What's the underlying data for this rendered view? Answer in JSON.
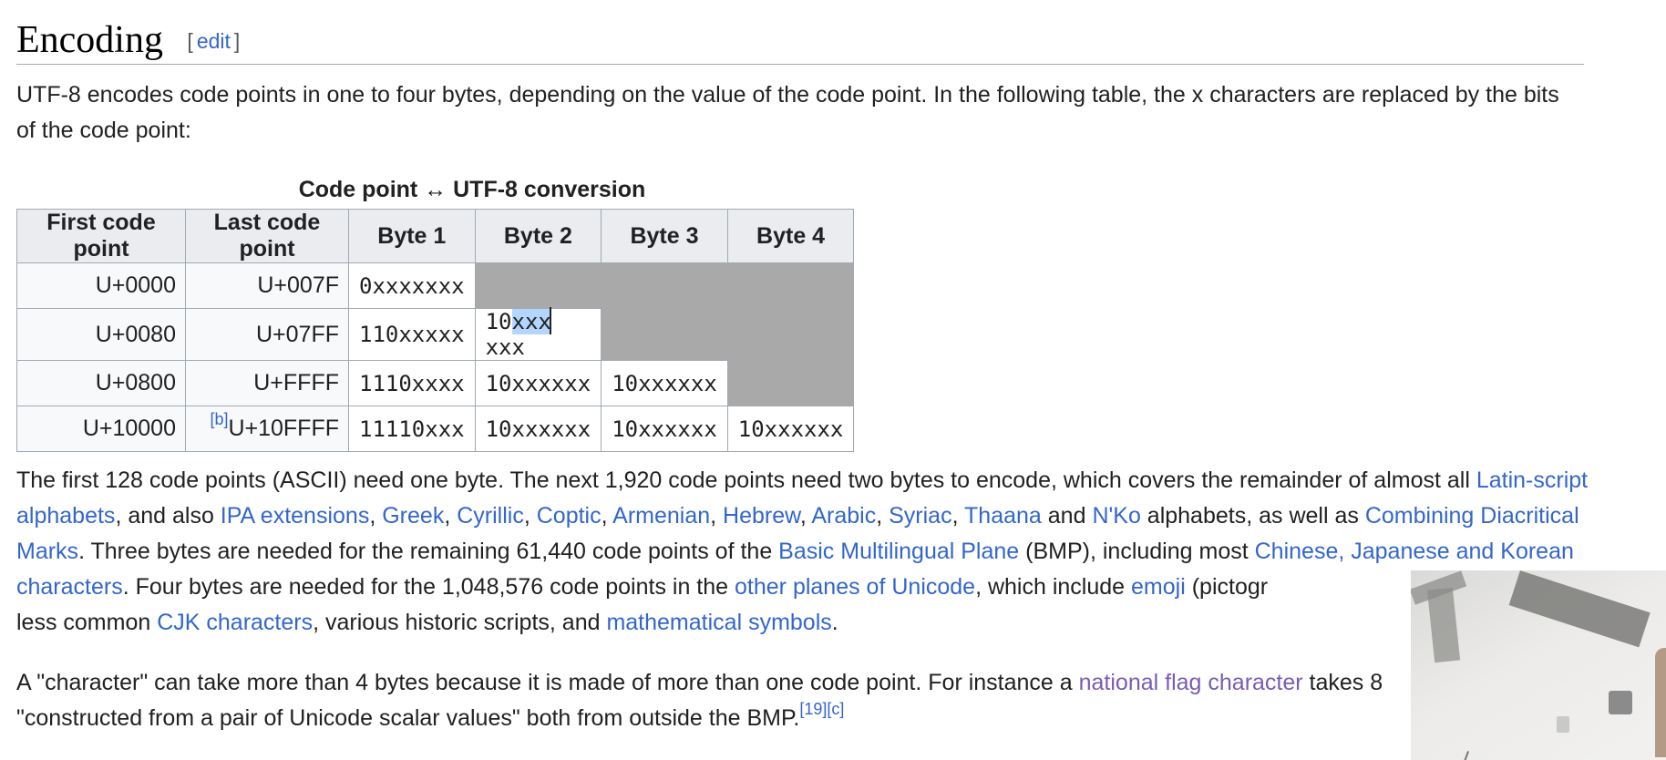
{
  "section": {
    "title": "Encoding",
    "edit_label": "edit",
    "bracket_open": "[",
    "bracket_close": "]"
  },
  "intro": {
    "t1": "UTF-8 encodes code points in one to four bytes, depending on the value of the code point. In the following table, the ",
    "x_char": "x",
    "t2": " characters are replaced by the bits of the code point:"
  },
  "table": {
    "caption": "Code point ↔ UTF-8 conversion",
    "headers": [
      "First code point",
      "Last code point",
      "Byte 1",
      "Byte 2",
      "Byte 3",
      "Byte 4"
    ],
    "rows": [
      {
        "first": "U+0000",
        "last": "U+007F",
        "bytes": [
          "0xxxxxxx"
        ]
      },
      {
        "first": "U+0080",
        "last": "U+07FF",
        "bytes": [
          "110xxxxx",
          "10xxxxxx"
        ]
      },
      {
        "first": "U+0800",
        "last": "U+FFFF",
        "bytes": [
          "1110xxxx",
          "10xxxxxx",
          "10xxxxxx"
        ]
      },
      {
        "first": "U+10000",
        "last": "U+10FFFF",
        "last_note": "[b]",
        "bytes": [
          "11110xxx",
          "10xxxxxx",
          "10xxxxxx",
          "10xxxxxx"
        ]
      }
    ],
    "selection": {
      "before": "10",
      "selected": "xxx",
      "after": "xxx"
    }
  },
  "para2": {
    "t1": "The first 128 code points (ASCII) need one byte. The next 1,920 code points need two bytes to encode, which covers the remainder of almost all ",
    "l_latin": "Latin-script alphabets",
    "t2": ", and also ",
    "l_ipa": "IPA extensions",
    "sep1": ", ",
    "l_greek": "Greek",
    "sep2": ", ",
    "l_cyrillic": "Cyrillic",
    "sep3": ", ",
    "l_coptic": "Coptic",
    "sep4": ", ",
    "l_armenian": "Armenian",
    "sep5": ", ",
    "l_hebrew": "Hebrew",
    "sep6": ", ",
    "l_arabic": "Arabic",
    "sep7": ", ",
    "l_syriac": "Syriac",
    "sep8": ", ",
    "l_thaana": "Thaana",
    "t_and": " and ",
    "l_nko": "N'Ko",
    "t3": " alphabets, as well as ",
    "l_combining": "Combining Diacritical Marks",
    "t4": ". Three bytes are needed for the remaining 61,440 code points of the ",
    "l_bmp": "Basic Multilingual Plane",
    "t5": " (BMP), including most ",
    "l_cjk_chars": "Chinese, Japanese and Korean characters",
    "t6": ". Four bytes are needed for the 1,048,576 code points in the ",
    "l_other_planes": "other planes of Unicode",
    "t7": ", which include ",
    "l_emoji": "emoji",
    "t8": " (pictogr",
    "t9": "less common ",
    "l_cjk": "CJK characters",
    "t10": ", various historic scripts, and ",
    "l_math": "mathematical symbols",
    "t11": "."
  },
  "para3": {
    "t1": "A \"character\" can take more than 4 bytes because it is made of more than one code point. For instance a ",
    "l_flag": "national flag character",
    "t2": " takes 8",
    "t3": "\"constructed from a pair of Unicode scalar values\" both from outside the BMP.",
    "ref1": "[19]",
    "ref2": "[c]"
  }
}
